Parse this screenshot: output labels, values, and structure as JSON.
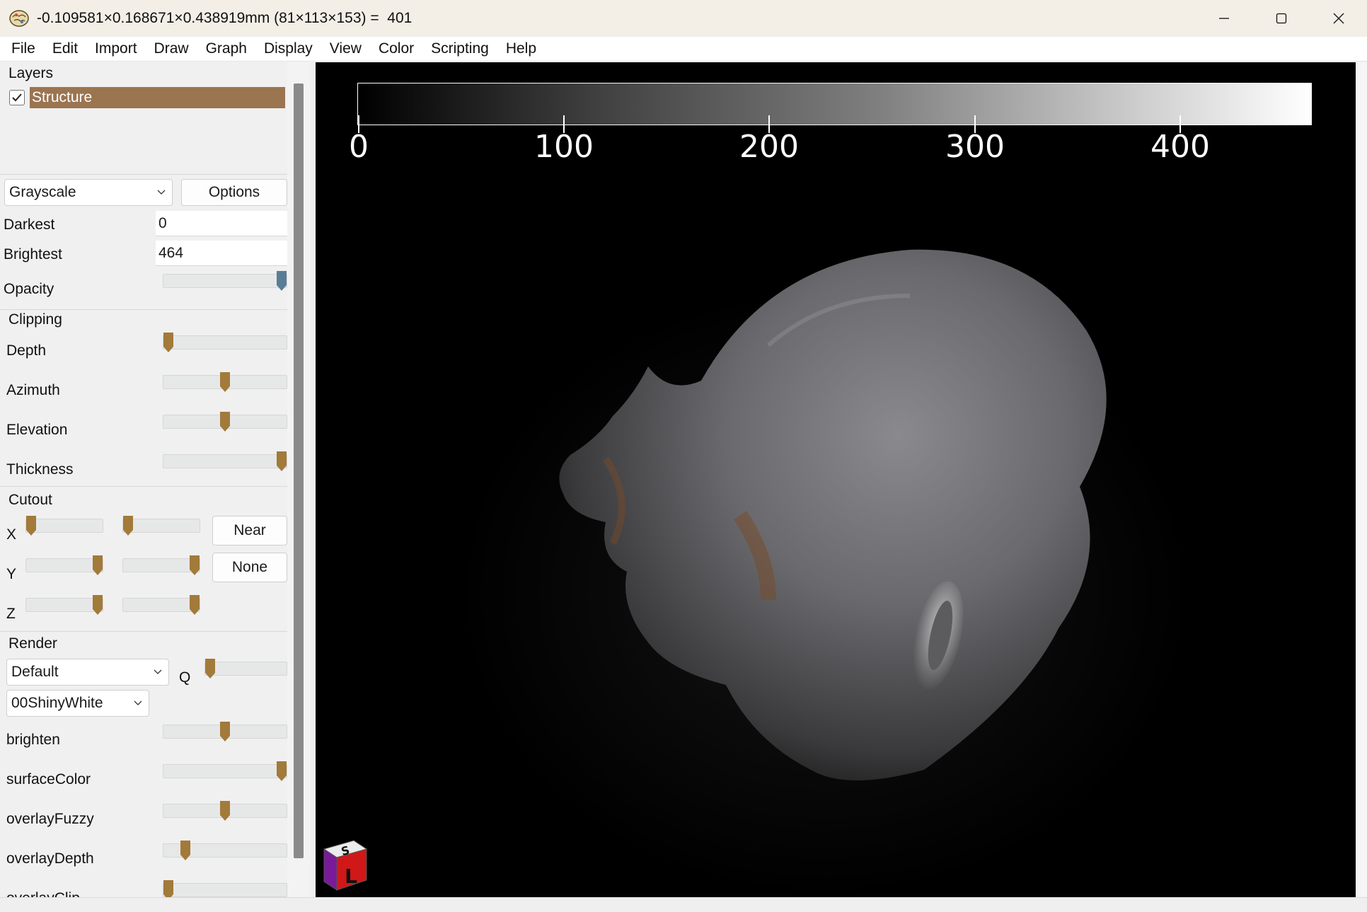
{
  "window": {
    "title": "-0.109581×0.168671×0.438919mm (81×113×153) =  401"
  },
  "menu": [
    "File",
    "Edit",
    "Import",
    "Draw",
    "Graph",
    "Display",
    "View",
    "Color",
    "Scripting",
    "Help"
  ],
  "layers": {
    "heading": "Layers",
    "items": [
      {
        "name": "Structure",
        "checked": true
      }
    ]
  },
  "color": {
    "colormap": "Grayscale",
    "options_label": "Options",
    "darkest_label": "Darkest",
    "darkest_value": "0",
    "brightest_label": "Brightest",
    "brightest_value": "464",
    "opacity_label": "Opacity",
    "opacity_level": 1.0
  },
  "clipping": {
    "heading": "Clipping",
    "depth_label": "Depth",
    "depth_level": 0.0,
    "azimuth_label": "Azimuth",
    "azimuth_level": 0.5,
    "elevation_label": "Elevation",
    "elevation_level": 0.5,
    "thickness_label": "Thickness",
    "thickness_level": 1.0
  },
  "cutout": {
    "heading": "Cutout",
    "x_label": "X",
    "y_label": "Y",
    "z_label": "Z",
    "x_levels": [
      0.0,
      0.0
    ],
    "y_levels": [
      1.0,
      1.0
    ],
    "z_levels": [
      1.0,
      1.0
    ],
    "near_label": "Near",
    "none_label": "None"
  },
  "render": {
    "heading": "Render",
    "mode": "Default",
    "q_label": "Q",
    "q_level": 0.0,
    "shader": "00ShinyWhite",
    "brighten_label": "brighten",
    "brighten_level": 0.5,
    "surfacecolor_label": "surfaceColor",
    "surfacecolor_level": 1.0,
    "overlayfuzzy_label": "overlayFuzzy",
    "overlayfuzzy_level": 0.5,
    "overlaydepth_label": "overlayDepth",
    "overlaydepth_level": 0.15,
    "overlayclip_label": "overlayClip",
    "overlayclip_level": 0.0
  },
  "colorbar": {
    "ticks": [
      "0",
      "100",
      "200",
      "300",
      "400"
    ]
  },
  "orientation_cube": {
    "top": "S",
    "front": "L"
  },
  "colors": {
    "accent": "#9b7450",
    "thumb": "#a27a3a",
    "opacity_thumb": "#5a7d96"
  }
}
